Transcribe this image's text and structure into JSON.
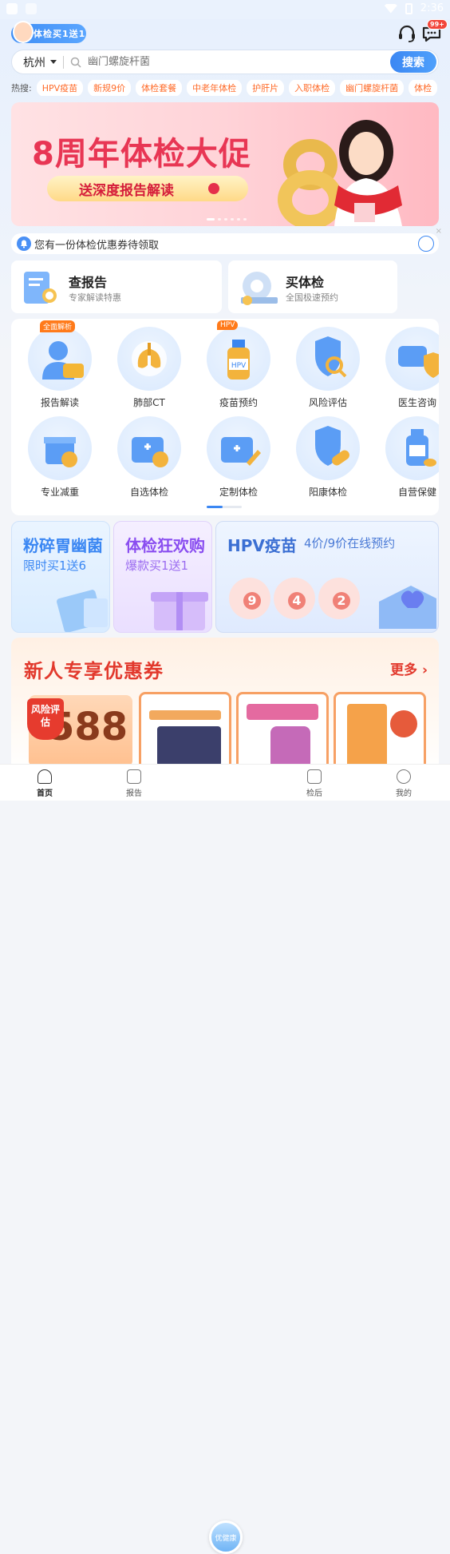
{
  "status": {
    "time": "2:36"
  },
  "header": {
    "promo_tag": "体检买1送1",
    "msg_badge": "99+"
  },
  "search": {
    "city": "杭州",
    "placeholder": "幽门螺旋杆菌",
    "button": "搜索"
  },
  "hot": {
    "label": "热搜:",
    "chips": [
      "HPV疫苗",
      "新规9价",
      "体检套餐",
      "中老年体检",
      "护肝片",
      "入职体检",
      "幽门螺旋杆菌",
      "体检"
    ]
  },
  "banner": {
    "title": "8周年体检大促",
    "subtitle": "送深度报告解读"
  },
  "notice": {
    "text": "您有一份体检优惠券待领取"
  },
  "quick": [
    {
      "title": "查报告",
      "sub": "专家解读特惠"
    },
    {
      "title": "买体检",
      "sub": "全国极速预约"
    }
  ],
  "grid": [
    {
      "label": "报告解读",
      "tag": "全面解析",
      "icon": "doctor-icon"
    },
    {
      "label": "肺部CT",
      "tag": "",
      "icon": "lungs-icon"
    },
    {
      "label": "疫苗预约",
      "tag": "HPV",
      "icon": "vaccine-bottle-icon"
    },
    {
      "label": "风险评估",
      "tag": "",
      "icon": "shield-search-icon"
    },
    {
      "label": "医生咨询",
      "tag": "",
      "icon": "chat-shield-icon"
    },
    {
      "label": "专业减重",
      "tag": "",
      "icon": "gift-box-icon"
    },
    {
      "label": "自选体检",
      "tag": "",
      "icon": "medkit-check-icon"
    },
    {
      "label": "定制体检",
      "tag": "",
      "icon": "medkit-pen-icon"
    },
    {
      "label": "阳康体检",
      "tag": "",
      "icon": "shield-pill-icon"
    },
    {
      "label": "自营保健",
      "tag": "",
      "icon": "medicine-bottle-icon"
    }
  ],
  "promos": [
    {
      "title": "粉碎胃幽菌",
      "sub": "限时买1送6"
    },
    {
      "title": "体检狂欢购",
      "sub": "爆款买1送1"
    },
    {
      "title": "HPV疫苗",
      "sub": "4价/9价在线预约",
      "vals": [
        "9",
        "4",
        "2"
      ]
    }
  ],
  "coupon": {
    "title": "新人专享优惠券",
    "more": "更多",
    "risk_tag": "风险评估",
    "amount": "588"
  },
  "tabs": [
    "首页",
    "报告",
    "优健康",
    "检后",
    "我的"
  ],
  "colors": {
    "accent": "#3b87f3",
    "hot": "#ff6b29",
    "red": "#e2392d"
  }
}
